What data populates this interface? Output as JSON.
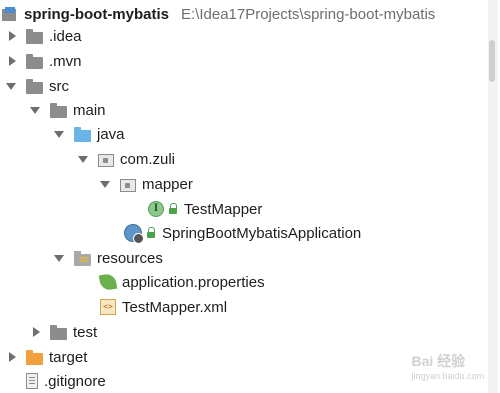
{
  "project": {
    "name": "spring-boot-mybatis",
    "path": "E:\\Idea17Projects\\spring-boot-mybatis"
  },
  "tree": {
    "idea": ".idea",
    "mvn": ".mvn",
    "src": "src",
    "main": "main",
    "java": "java",
    "com_zuli": "com.zuli",
    "mapper": "mapper",
    "test_mapper": "TestMapper",
    "app": "SpringBootMybatisApplication",
    "resources": "resources",
    "app_props": "application.properties",
    "test_mapper_xml": "TestMapper.xml",
    "test": "test",
    "target": "target",
    "gitignore": ".gitignore"
  },
  "icons": {
    "interface_letter": "I",
    "xml_glyph": "<>"
  },
  "watermark": {
    "main": "Bai 经验",
    "sub": "jingyan.baidu.com"
  }
}
